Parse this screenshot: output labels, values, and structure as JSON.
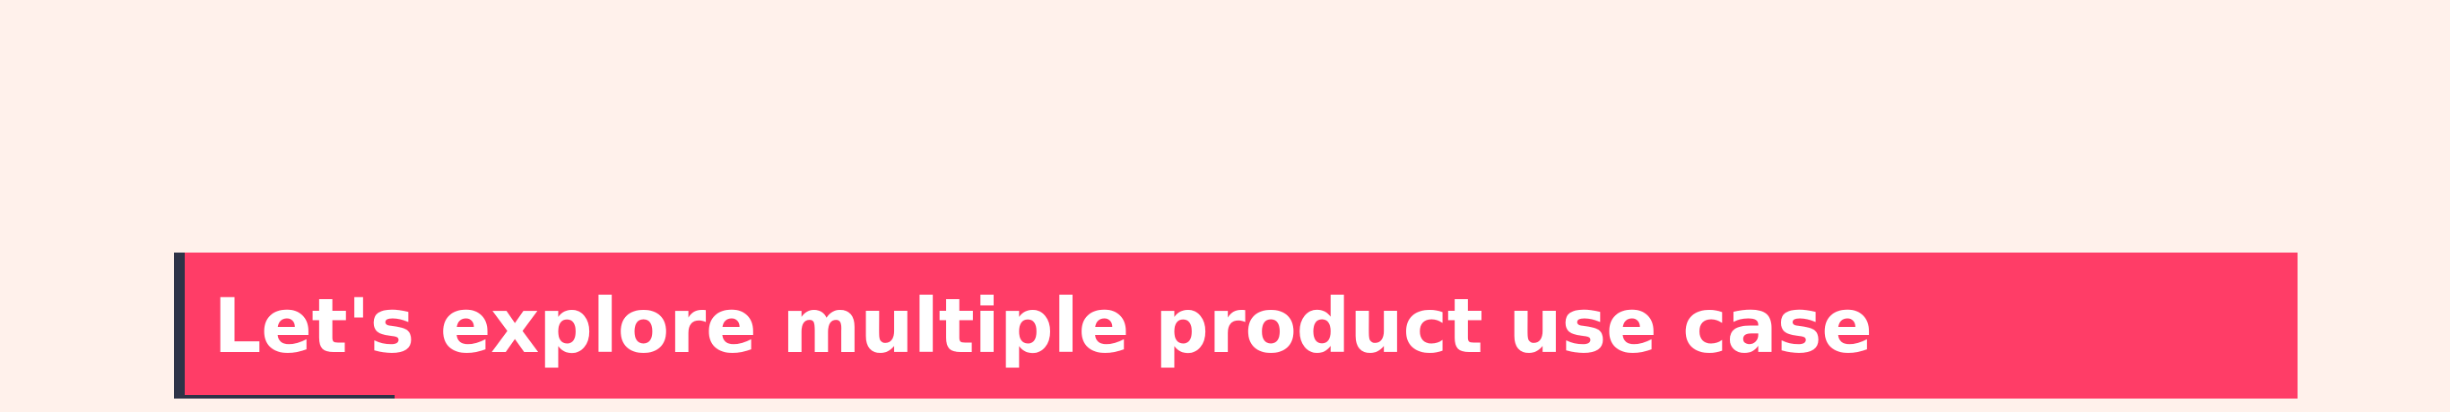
{
  "banner": {
    "title": "Let's explore multiple product use case"
  },
  "colors": {
    "page_background": "#FFF1EB",
    "banner_background": "#FF3D67",
    "banner_accent": "#2E3347",
    "title_text": "#FFFFFF"
  }
}
